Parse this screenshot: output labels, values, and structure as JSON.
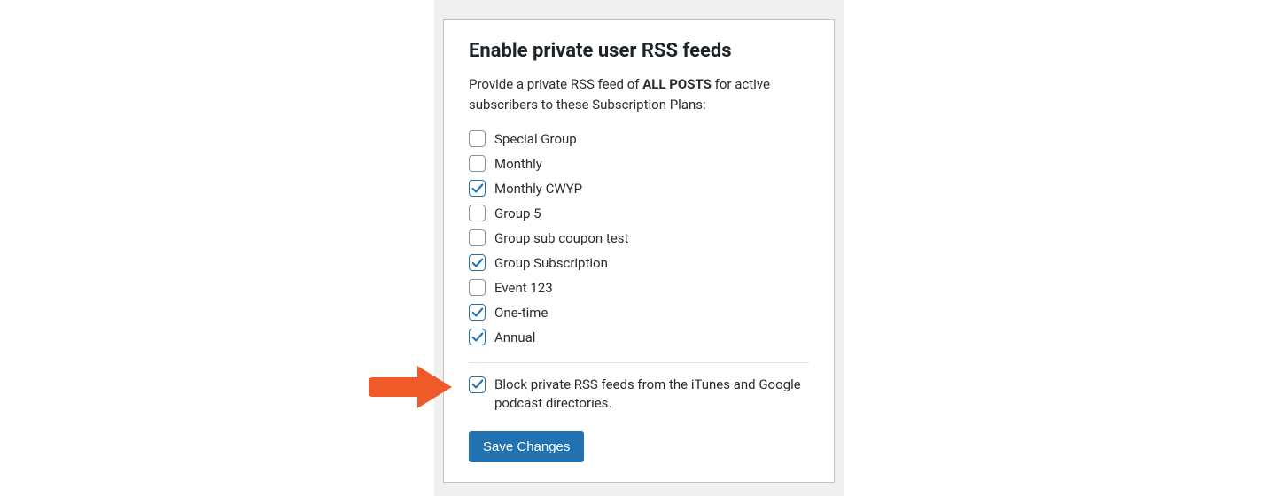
{
  "panel": {
    "title": "Enable private user RSS feeds",
    "desc_prefix": "Provide a private RSS feed of ",
    "desc_bold": "ALL POSTS",
    "desc_suffix": " for active subscribers to these Subscription Plans:",
    "plans": [
      {
        "label": "Special Group",
        "checked": false
      },
      {
        "label": "Monthly",
        "checked": false
      },
      {
        "label": "Monthly CWYP",
        "checked": true
      },
      {
        "label": "Group 5",
        "checked": false
      },
      {
        "label": "Group sub coupon test",
        "checked": false
      },
      {
        "label": "Group Subscription",
        "checked": true
      },
      {
        "label": "Event 123",
        "checked": false
      },
      {
        "label": "One-time",
        "checked": true
      },
      {
        "label": "Annual",
        "checked": true
      }
    ],
    "block_option": {
      "label": "Block private RSS feeds from the iTunes and Google podcast directories.",
      "checked": true
    },
    "save_label": "Save Changes"
  },
  "colors": {
    "arrow": "#f05a28",
    "primary": "#2271b1"
  }
}
